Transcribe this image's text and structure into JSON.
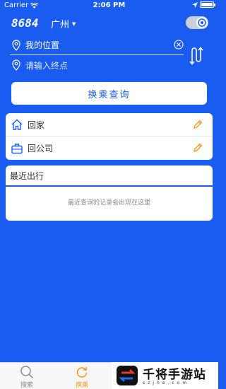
{
  "status_bar": {
    "carrier": "Carrier",
    "time": "2:06 PM"
  },
  "header": {
    "logo": "8684",
    "city": "广州",
    "city_caret_icon": "caret-down-icon",
    "toggle_state": "on"
  },
  "route": {
    "start_value": "我的位置",
    "end_placeholder": "请输入终点"
  },
  "search_button": {
    "label": "换乘查询"
  },
  "favorites": [
    {
      "label": "回家",
      "icon": "home-icon"
    },
    {
      "label": "回公司",
      "icon": "briefcase-icon"
    }
  ],
  "recent": {
    "title": "最近出行",
    "empty_text": "最近查询的记录会出现在这里"
  },
  "tabbar": {
    "tabs": [
      {
        "label": "搜索",
        "icon": "search-icon",
        "active": false
      },
      {
        "label": "换乘",
        "icon": "refresh-icon",
        "active": true
      }
    ]
  },
  "watermark": {
    "title": "千将手游站",
    "domain": "szjhe.com"
  },
  "colors": {
    "background": "#1a5cf0",
    "accent": "#f39a17",
    "card": "#ffffff"
  }
}
